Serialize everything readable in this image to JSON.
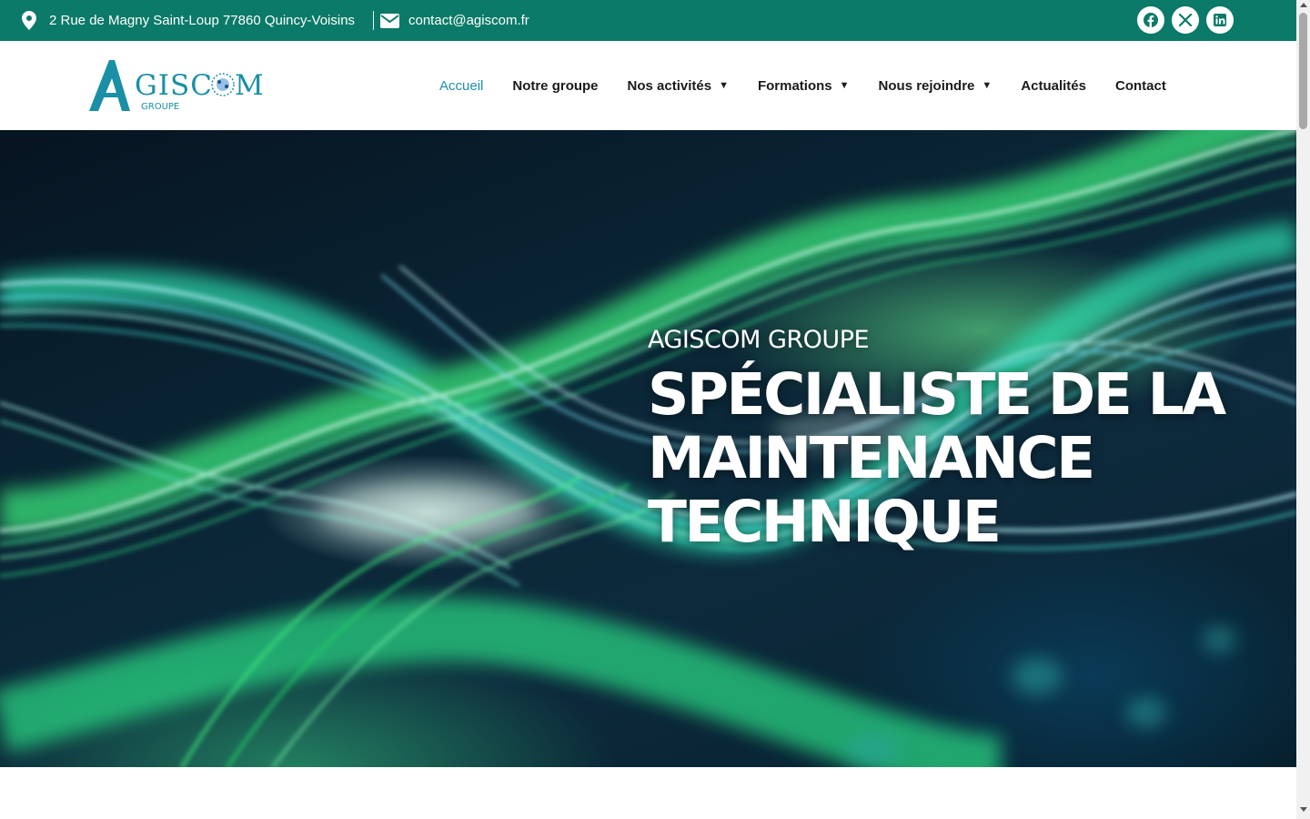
{
  "topbar": {
    "address": "2 Rue de Magny Saint-Loup 77860 Quincy-Voisins",
    "email": "contact@agiscom.fr",
    "icons": {
      "address": "map-pin-icon",
      "email": "envelope-icon"
    },
    "socials": [
      "facebook-icon",
      "x-twitter-icon",
      "linkedin-icon"
    ],
    "bg_color": "#0b7a68"
  },
  "logo": {
    "main": "AGISCOM",
    "sub": "GROUPE",
    "color": "#1a8fa6"
  },
  "nav": {
    "items": [
      {
        "label": "Accueil",
        "active": true,
        "dropdown": false
      },
      {
        "label": "Notre groupe",
        "active": false,
        "dropdown": false
      },
      {
        "label": "Nos activités",
        "active": false,
        "dropdown": true
      },
      {
        "label": "Formations",
        "active": false,
        "dropdown": true
      },
      {
        "label": "Nous rejoindre",
        "active": false,
        "dropdown": true
      },
      {
        "label": "Actualités",
        "active": false,
        "dropdown": false
      },
      {
        "label": "Contact",
        "active": false,
        "dropdown": false
      }
    ],
    "active_color": "#1a8fb0"
  },
  "hero": {
    "subtitle": "AGISCOM GROUPE",
    "title_lines": [
      "SPÉCIALISTE DE LA",
      "MAINTENANCE",
      "TECHNIQUE"
    ]
  }
}
